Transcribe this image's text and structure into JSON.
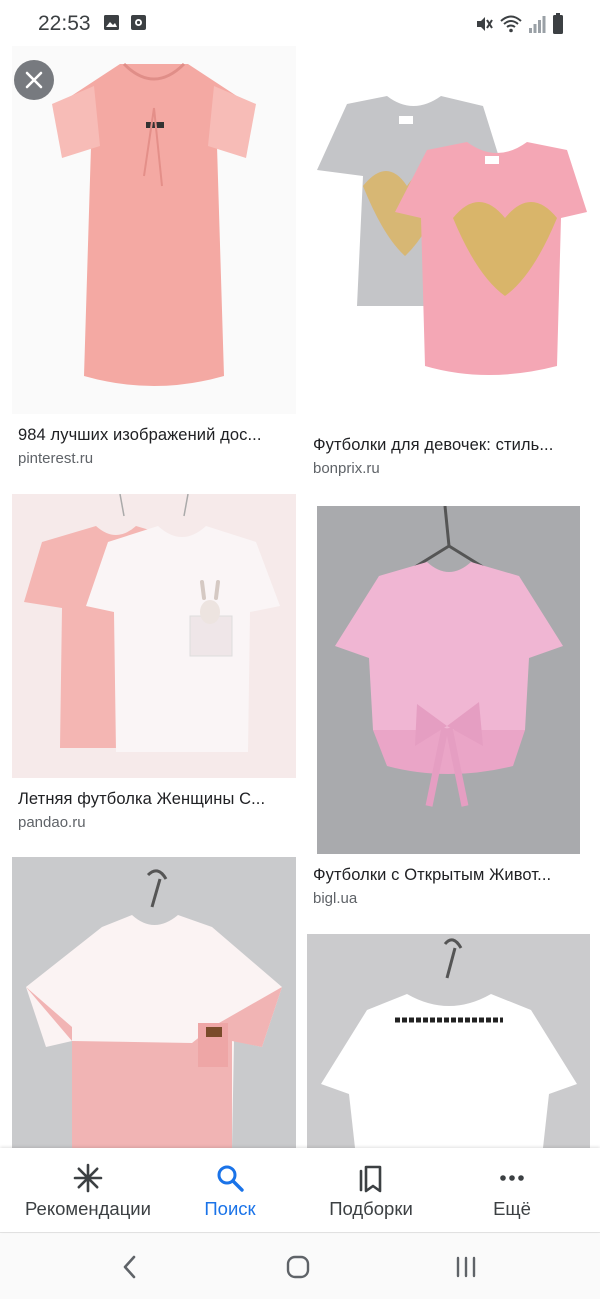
{
  "status_bar": {
    "time": "22:53",
    "left_icons": [
      "image-icon",
      "record-icon"
    ],
    "right_icons": [
      "mute-icon",
      "wifi-icon",
      "signal-icon",
      "battery-icon"
    ]
  },
  "results": [
    {
      "title": "984 лучших изображений дос...",
      "source": "pinterest.ru"
    },
    {
      "title": "Футболки для девочек: стиль...",
      "source": "bonprix.ru"
    },
    {
      "title": "Летняя футболка Женщины С...",
      "source": "pandao.ru"
    },
    {
      "title": "Футболки с Открытым Живот...",
      "source": "bigl.ua"
    },
    {
      "title": "",
      "source": ""
    },
    {
      "title": "",
      "source": ""
    }
  ],
  "bottom_nav": {
    "items": [
      {
        "label": "Рекомендации",
        "icon": "asterisk-icon",
        "active": false
      },
      {
        "label": "Поиск",
        "icon": "search-icon",
        "active": true
      },
      {
        "label": "Подборки",
        "icon": "collections-icon",
        "active": false
      },
      {
        "label": "Ещё",
        "icon": "more-icon",
        "active": false
      }
    ]
  },
  "system_nav": [
    "back-icon",
    "home-icon",
    "recents-icon"
  ],
  "colors": {
    "accent": "#1a73e8",
    "text_primary": "#202124",
    "text_secondary": "#5f6368",
    "shirt_pink": "#f4a9a3",
    "shirt_lilac": "#f0b6d3",
    "shirt_grey": "#c4c5c8"
  }
}
